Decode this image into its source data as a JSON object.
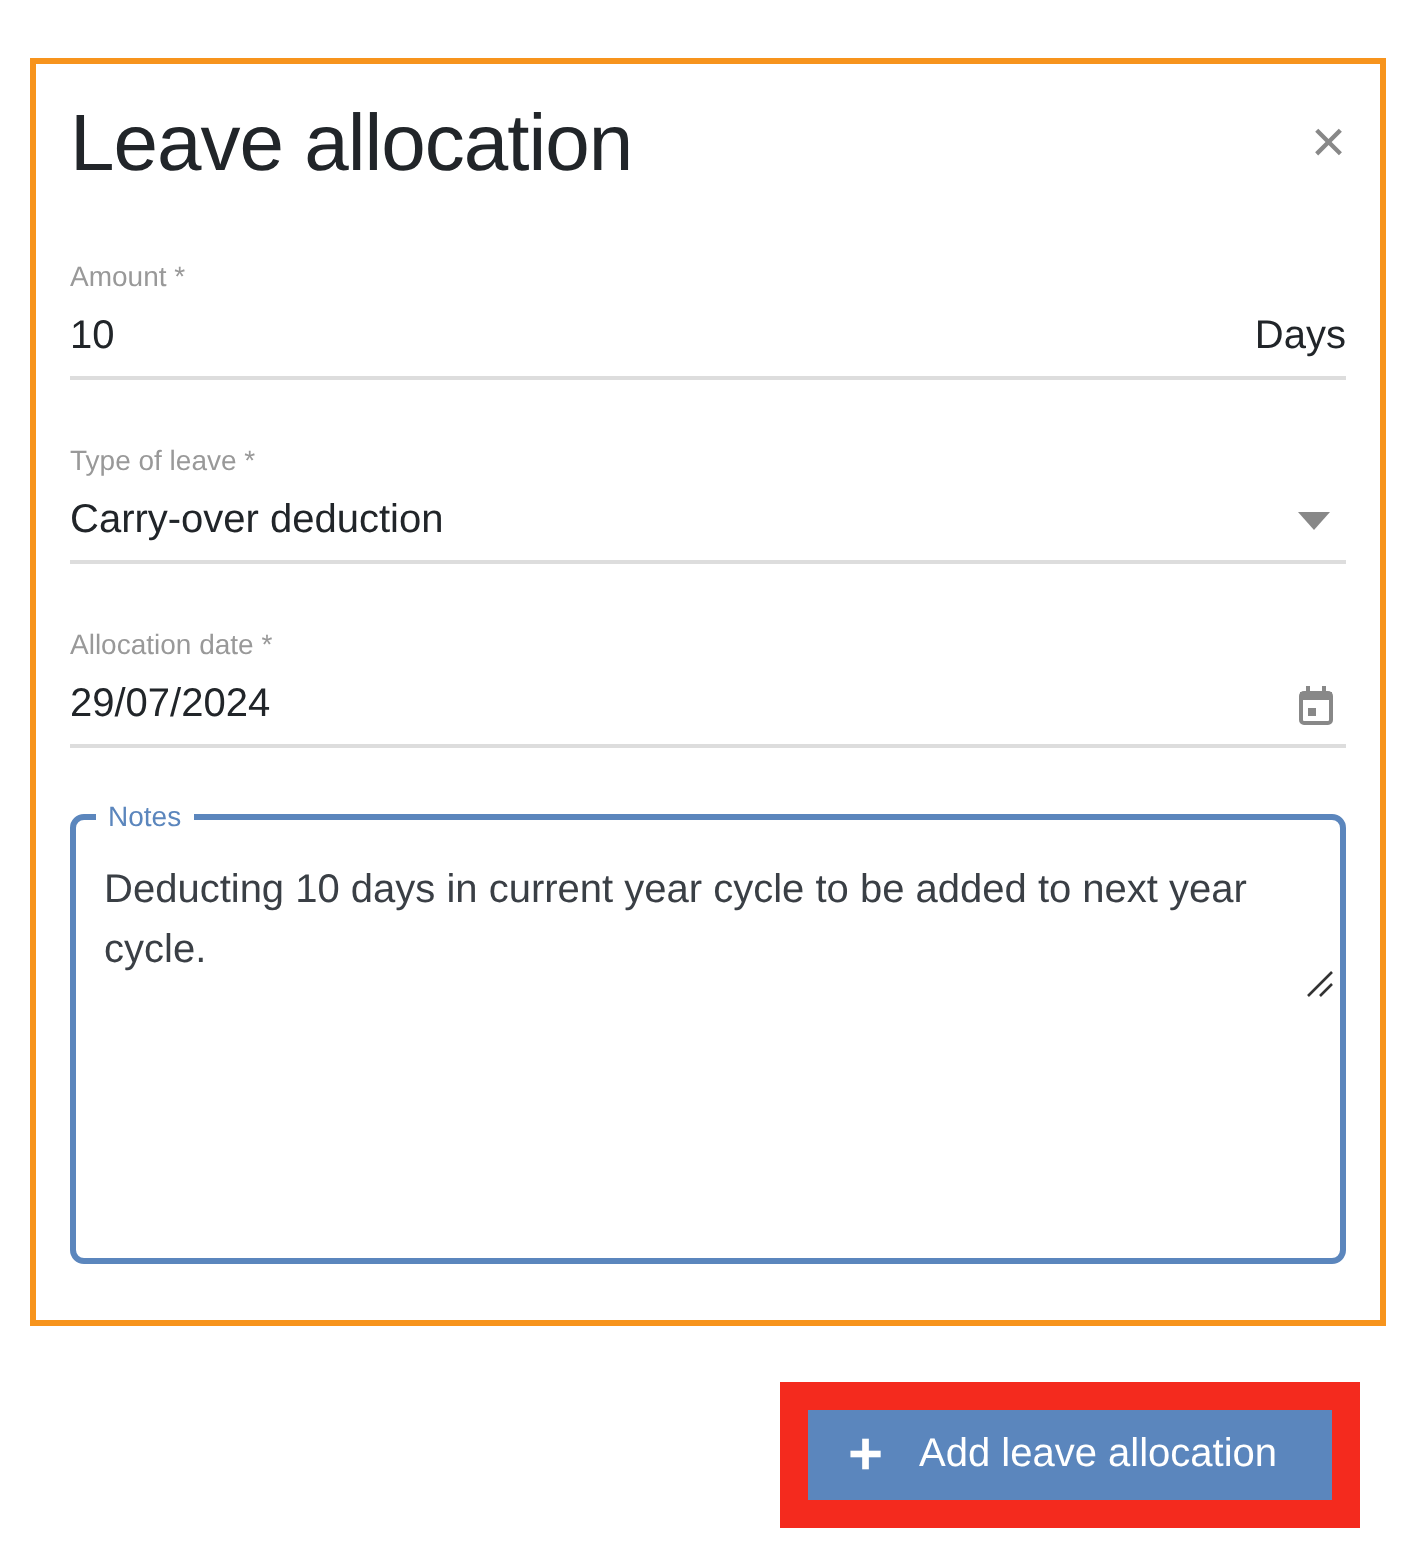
{
  "dialog": {
    "title": "Leave allocation",
    "close": "×"
  },
  "fields": [
    {
      "kind": "text",
      "label": "Amount *",
      "value": "10",
      "suffix": "Days"
    },
    {
      "kind": "select",
      "label": "Type of leave *",
      "value": "Carry-over deduction"
    },
    {
      "kind": "date",
      "label": "Allocation date *",
      "value": "29/07/2024"
    }
  ],
  "notes": {
    "label": "Notes",
    "value": "Deducting 10 days in current year cycle to be added to next year cycle.",
    "focused": true
  },
  "buttons": [
    {
      "icon": "+",
      "label": "Add leave allocation"
    }
  ]
}
